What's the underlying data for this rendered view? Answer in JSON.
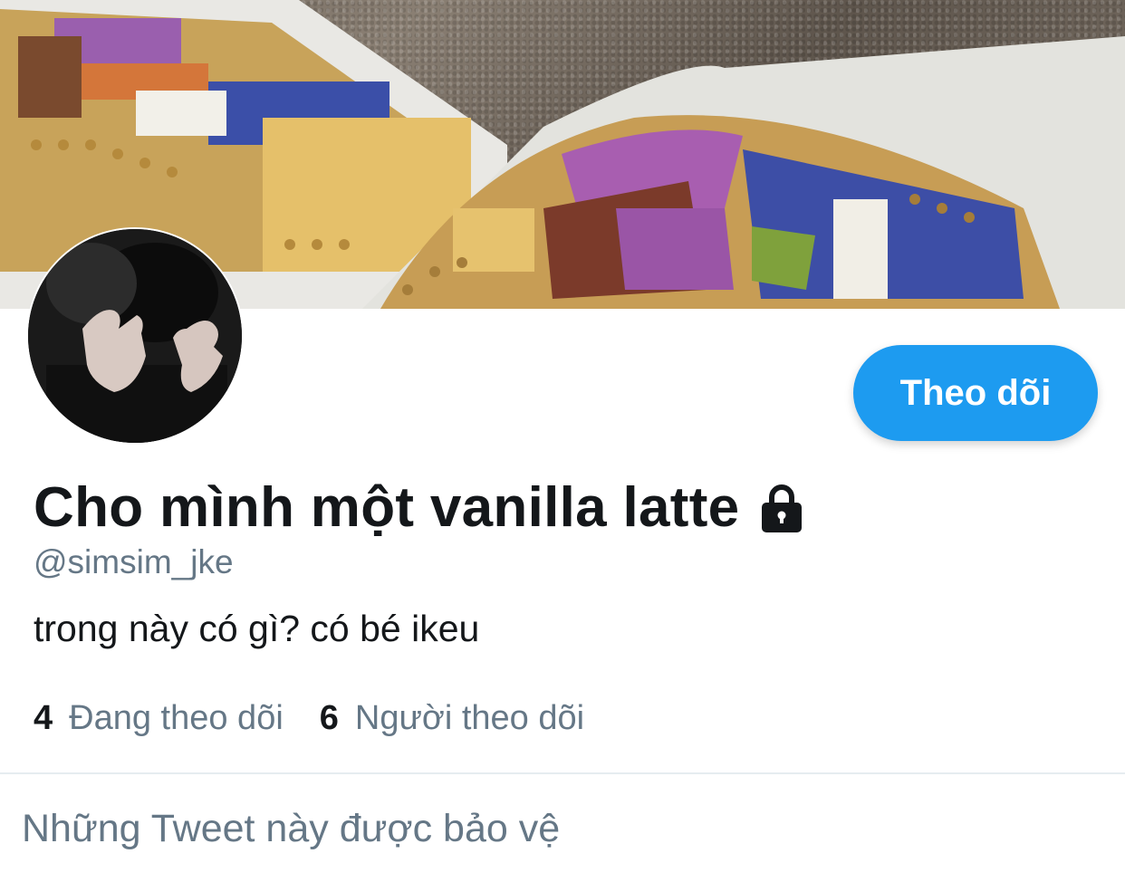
{
  "profile": {
    "display_name": "Cho mình một vanilla latte",
    "handle": "@simsim_jke",
    "bio": "trong này có gì? có bé ikeu",
    "protected_icon": "lock-icon"
  },
  "actions": {
    "follow_label": "Theo dõi"
  },
  "stats": {
    "following_count": "4",
    "following_label": "Đang theo dõi",
    "followers_count": "6",
    "followers_label": "Người theo dõi"
  },
  "timeline": {
    "protected_message": "Những Tweet này được bảo vệ"
  },
  "colors": {
    "accent": "#1d9bf0",
    "text_primary": "#14171a",
    "text_secondary": "#657786",
    "divider": "#e6ecf0"
  }
}
